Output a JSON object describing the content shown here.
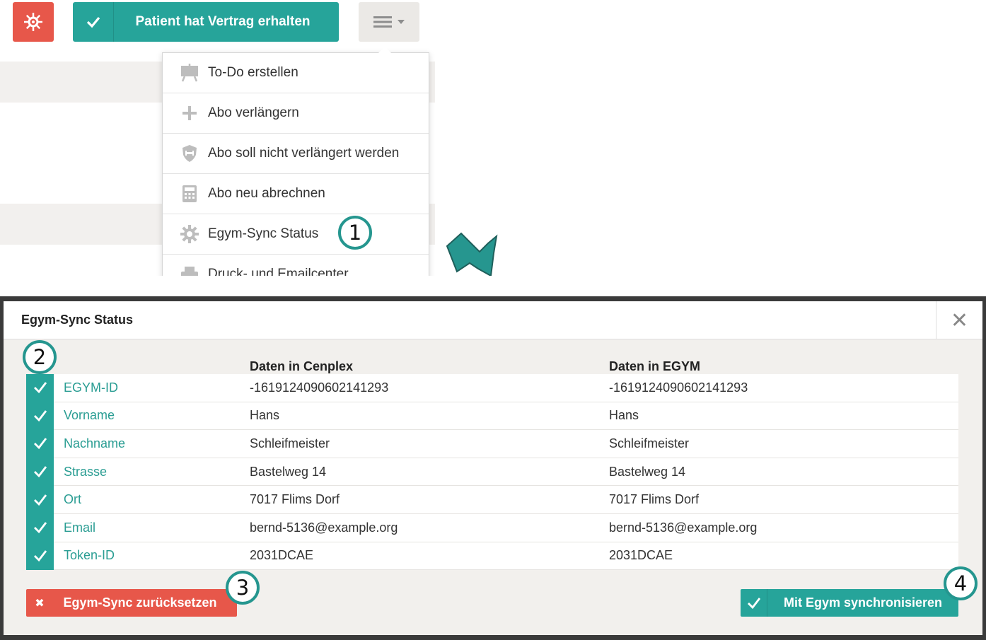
{
  "top": {
    "contract_button_label": "Patient hat Vertrag erhalten",
    "menu": [
      {
        "label": "To-Do erstellen",
        "icon": "easel-icon"
      },
      {
        "label": "Abo verlängern",
        "icon": "plus-icon"
      },
      {
        "label": "Abo soll nicht verlängert werden",
        "icon": "shield-icon"
      },
      {
        "label": "Abo neu abrechnen",
        "icon": "calculator-icon"
      },
      {
        "label": "Egym-Sync Status",
        "icon": "gear-icon"
      },
      {
        "label": "Druck- und Emailcenter",
        "icon": "printer-icon"
      }
    ]
  },
  "badges": {
    "b1": "1",
    "b2": "2",
    "b3": "3",
    "b4": "4"
  },
  "modal": {
    "title": "Egym-Sync Status",
    "col_cenplex": "Daten in Cenplex",
    "col_egym": "Daten in EGYM",
    "rows": [
      {
        "field": "EGYM-ID",
        "cenplex": "-1619124090602141293",
        "egym": "-1619124090602141293"
      },
      {
        "field": "Vorname",
        "cenplex": "Hans",
        "egym": "Hans"
      },
      {
        "field": "Nachname",
        "cenplex": "Schleifmeister",
        "egym": "Schleifmeister"
      },
      {
        "field": "Strasse",
        "cenplex": "Bastelweg 14",
        "egym": "Bastelweg 14"
      },
      {
        "field": "Ort",
        "cenplex": "7017 Flims Dorf",
        "egym": "7017 Flims Dorf"
      },
      {
        "field": "Email",
        "cenplex": "bernd-5136@example.org",
        "egym": "bernd-5136@example.org"
      },
      {
        "field": "Token-ID",
        "cenplex": "2031DCAE",
        "egym": "2031DCAE"
      }
    ],
    "reset_label": "Egym-Sync zurücksetzen",
    "sync_label": "Mit Egym synchronisieren"
  },
  "colors": {
    "teal": "#26a49a",
    "red": "#e7574a",
    "badge_border": "#25968f"
  }
}
